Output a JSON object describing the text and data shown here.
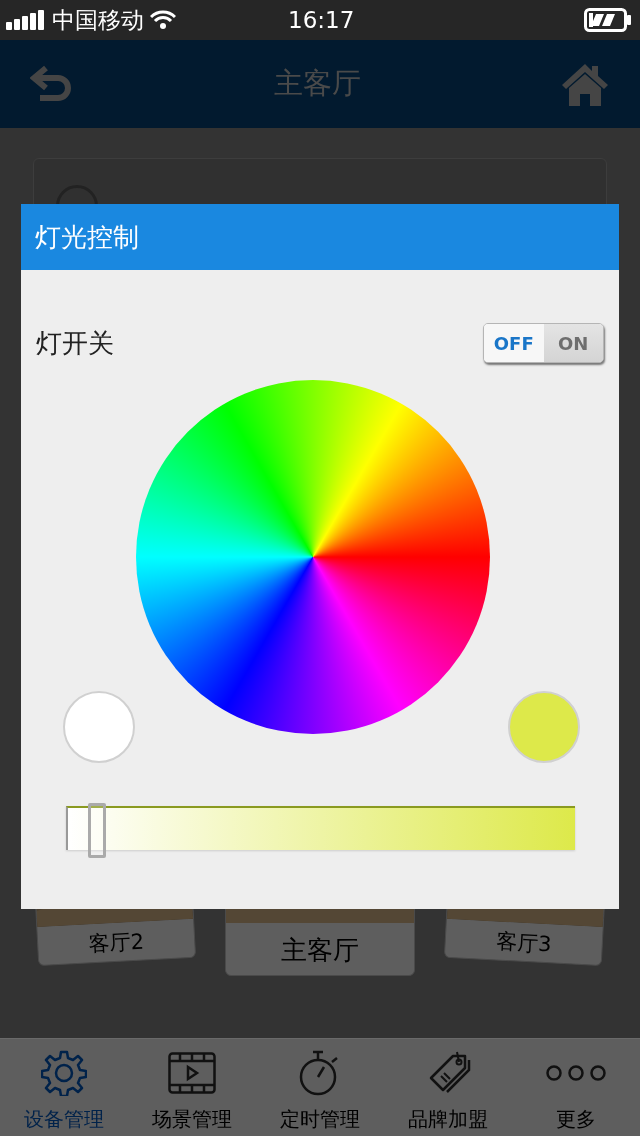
{
  "status_bar": {
    "carrier": "中国移动",
    "time": "16:17"
  },
  "nav_bar": {
    "title": "主客厅"
  },
  "rooms": [
    {
      "label": "客厅2",
      "selected": false
    },
    {
      "label": "主客厅",
      "selected": true
    },
    {
      "label": "客厅3",
      "selected": false
    }
  ],
  "dialog": {
    "title": "灯光控制",
    "switch": {
      "label": "灯开关",
      "off_label": "OFF",
      "on_label": "ON",
      "on": false
    },
    "swatches": [
      {
        "color": "#ffffff"
      },
      {
        "color": "#dde94a"
      }
    ],
    "brightness": {
      "level": 0.06
    }
  },
  "tabs": [
    {
      "label": "设备管理",
      "selected": true
    },
    {
      "label": "场景管理",
      "selected": false
    },
    {
      "label": "定时管理",
      "selected": false
    },
    {
      "label": "品牌加盟",
      "selected": false
    },
    {
      "label": "更多",
      "selected": false
    }
  ]
}
